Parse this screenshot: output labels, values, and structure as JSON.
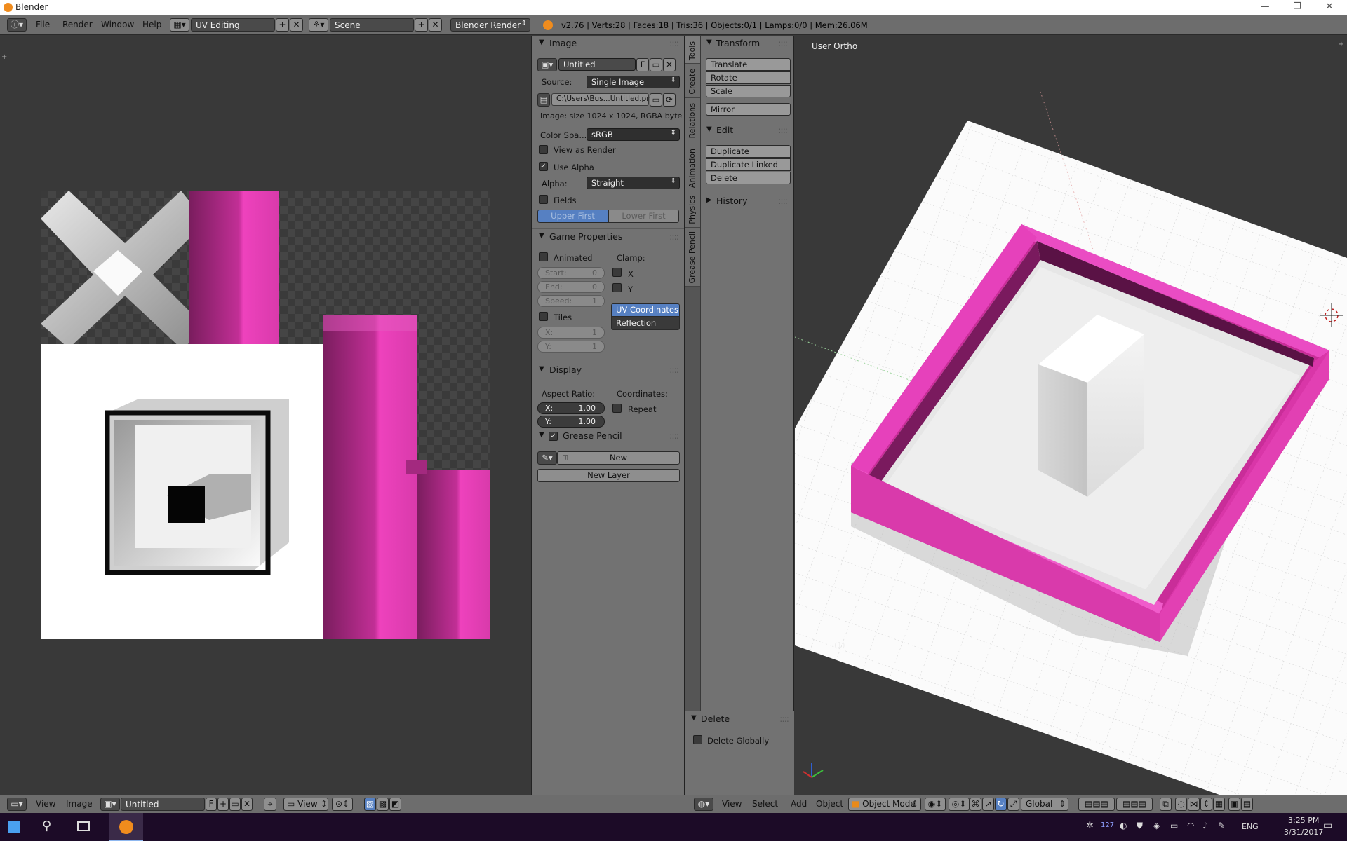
{
  "window": {
    "title": "Blender"
  },
  "topbar": {
    "menus": [
      "File",
      "Render",
      "Window",
      "Help"
    ],
    "screen_layout": "UV Editing",
    "scene": "Scene",
    "render_engine": "Blender Render",
    "stats": "v2.76 | Verts:28 | Faces:18 | Tris:36 | Objects:0/1 | Lamps:0/0 | Mem:26.06M"
  },
  "image_panel": {
    "header": "Image",
    "image_name": "Untitled",
    "fake_user": "F",
    "source_label": "Source:",
    "source_value": "Single Image",
    "filepath": "C:\\Users\\Bus...Untitled.png",
    "info": "Image: size 1024 x 1024, RGBA byte",
    "color_space_label": "Color Spa...",
    "color_space_value": "sRGB",
    "view_as_render": "View as Render",
    "use_alpha": "Use Alpha",
    "alpha_label": "Alpha:",
    "alpha_value": "Straight",
    "fields": "Fields",
    "upper_first": "Upper First",
    "lower_first": "Lower First"
  },
  "game_panel": {
    "header": "Game Properties",
    "animated": "Animated",
    "clamp": "Clamp:",
    "x": "X",
    "y": "Y",
    "start_label": "Start:",
    "start_value": "0",
    "end_label": "End:",
    "end_value": "0",
    "speed_label": "Speed:",
    "speed_value": "1",
    "uv_coordinates": "UV Coordinates",
    "reflection": "Reflection",
    "tiles": "Tiles",
    "tiles_x_label": "X:",
    "tiles_x_value": "1",
    "tiles_y_label": "Y:",
    "tiles_y_value": "1"
  },
  "display_panel": {
    "header": "Display",
    "aspect_ratio": "Aspect Ratio:",
    "coordinates": "Coordinates:",
    "x_label": "X:",
    "x_value": "1.00",
    "y_label": "Y:",
    "y_value": "1.00",
    "repeat": "Repeat"
  },
  "grease_panel": {
    "header": "Grease Pencil",
    "new": "New",
    "new_layer": "New Layer"
  },
  "vtabs": [
    "Tools",
    "Create",
    "Relations",
    "Animation",
    "Physics",
    "Grease Pencil"
  ],
  "tool_shelf": {
    "transform_header": "Transform",
    "translate": "Translate",
    "rotate": "Rotate",
    "scale": "Scale",
    "mirror": "Mirror",
    "edit_header": "Edit",
    "duplicate": "Duplicate",
    "duplicate_linked": "Duplicate Linked",
    "delete": "Delete",
    "history_header": "History",
    "delete_header": "Delete",
    "delete_globally": "Delete Globally"
  },
  "viewport": {
    "label": "User Ortho",
    "frame": "(1)"
  },
  "image_footer": {
    "view": "View",
    "image": "Image",
    "image_name": "Untitled",
    "fake_user": "F",
    "view_dropdown": "View"
  },
  "view3d_footer": {
    "view": "View",
    "select": "Select",
    "add": "Add",
    "object": "Object",
    "mode": "Object Mode",
    "orientation": "Global"
  },
  "taskbar": {
    "badge": "127",
    "lang": "ENG",
    "time": "3:25 PM",
    "date": "3/31/2017"
  },
  "colors": {
    "accent_blue": "#5680c2",
    "magenta": "#e63bb4",
    "blender_orange": "#f08c1d"
  }
}
